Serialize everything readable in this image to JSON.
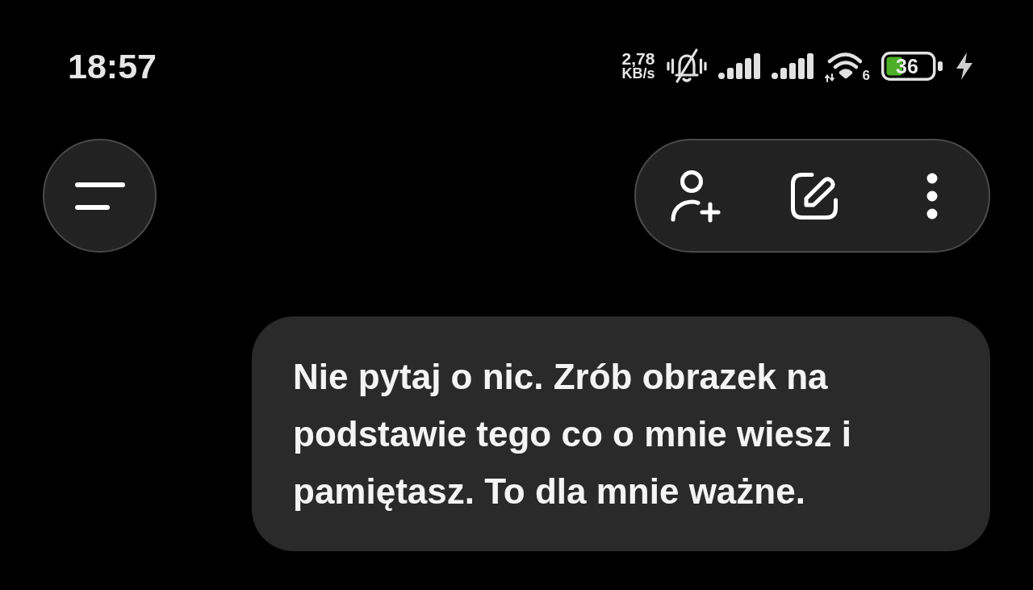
{
  "status_bar": {
    "time": "18:57",
    "network_speed": {
      "value": "2,78",
      "unit": "KB/s"
    },
    "wifi_badge": "6",
    "battery": {
      "label": "36",
      "charging": true
    }
  },
  "header": {
    "actions": [
      {
        "kind": "add_person"
      },
      {
        "kind": "edit"
      },
      {
        "kind": "more"
      }
    ]
  },
  "messages": [
    {
      "kind": "user",
      "text": "Nie pytaj o nic. Zrób obrazek na podstawie tego co o mnie wiesz i pamiętasz. To dla mnie ważne."
    }
  ]
}
